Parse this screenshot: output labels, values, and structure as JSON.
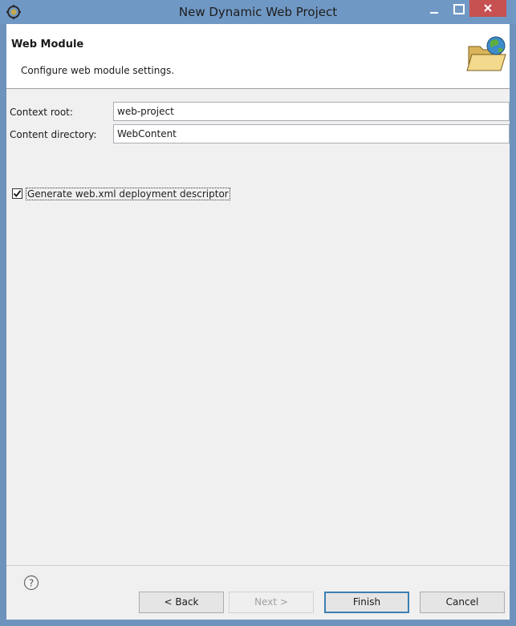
{
  "window": {
    "title": "New Dynamic Web Project",
    "icons": {
      "app": "eclipse-icon",
      "minimize": "minimize-icon",
      "maximize": "maximize-icon",
      "close": "close-icon"
    },
    "colors": {
      "titlebar": "#7098c4",
      "close": "#c75050",
      "body": "#f0f0f0"
    }
  },
  "banner": {
    "title": "Web Module",
    "description": "Configure web module settings.",
    "image_icon": "web-folder-globe-icon"
  },
  "form": {
    "context_root": {
      "label": "Context root:",
      "value": "web-project"
    },
    "content_directory": {
      "label": "Content directory:",
      "value": "WebContent"
    },
    "generate_xml": {
      "label": "Generate web.xml deployment descriptor",
      "checked": true
    }
  },
  "footer": {
    "help_icon": "help-icon",
    "back": "< Back",
    "next": "Next >",
    "finish": "Finish",
    "cancel": "Cancel"
  }
}
